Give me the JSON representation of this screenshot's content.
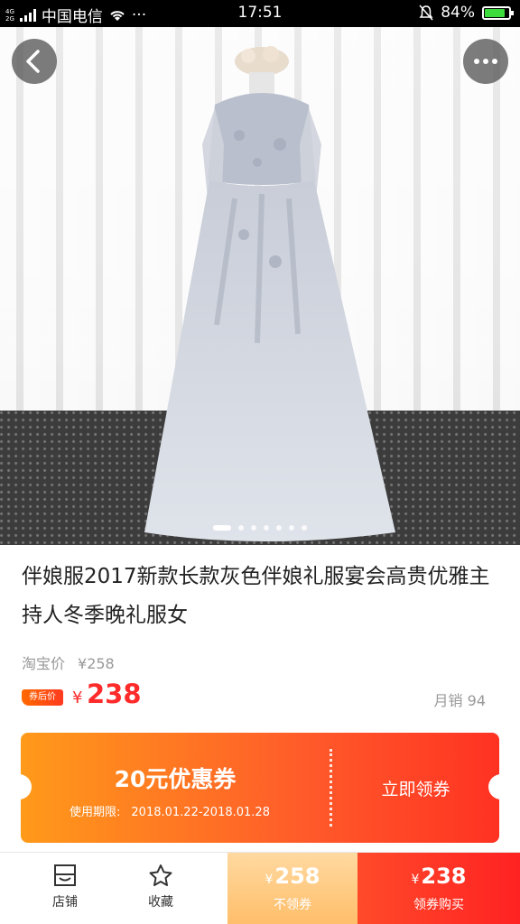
{
  "status_bar": {
    "net_top": "4G",
    "net_bottom": "2G",
    "carrier": "中国电信",
    "more": "···",
    "time": "17:51",
    "battery": "84%",
    "battery_level": 0.84
  },
  "gallery": {
    "image_count": 7,
    "active_index": 0
  },
  "product": {
    "title": "伴娘服2017新款长款灰色伴娘礼服宴会高贵优雅主持人冬季晚礼服女",
    "taobao_label": "淘宝价",
    "taobao_price": "¥258",
    "coupon_tag": "券后价",
    "price_symbol": "¥",
    "price": "238",
    "monthly_sales": "月销 94"
  },
  "coupon": {
    "amount": "20元优惠券",
    "validity_label": "使用期限:",
    "validity_range": "2018.01.22-2018.01.28",
    "claim_label": "立即领券"
  },
  "bottom_bar": {
    "store_label": "店铺",
    "favorite_label": "收藏",
    "no_coupon_symbol": "¥",
    "no_coupon_price": "258",
    "no_coupon_label": "不领券",
    "coupon_symbol": "¥",
    "coupon_price": "238",
    "coupon_label": "领券购买"
  },
  "colors": {
    "accent": "#ff2a2a",
    "coupon_start": "#ff9a1a",
    "coupon_end": "#ff3222"
  }
}
